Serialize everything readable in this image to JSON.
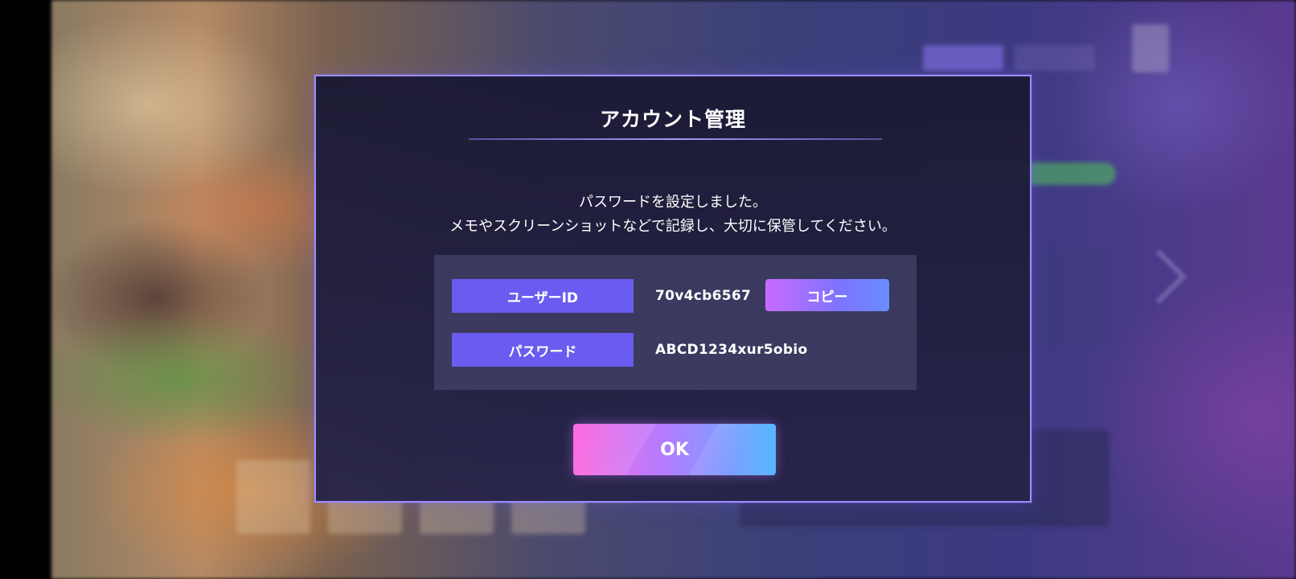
{
  "dialog": {
    "title": "アカウント管理",
    "message_line1": "パスワードを設定しました。",
    "message_line2": "メモやスクリーンショットなどで記録し、大切に保管してください。",
    "user_id_label": "ユーザーID",
    "user_id_value": "70v4cb6567",
    "copy_label": "コピー",
    "password_label": "パスワード",
    "password_value": "ABCD1234xur5obio",
    "ok_label": "OK"
  },
  "colors": {
    "accent": "#6a5cf0",
    "dialog_border": "#9b8cff",
    "ok_gradient_start": "#ff6adf",
    "ok_gradient_end": "#57b7ff"
  }
}
